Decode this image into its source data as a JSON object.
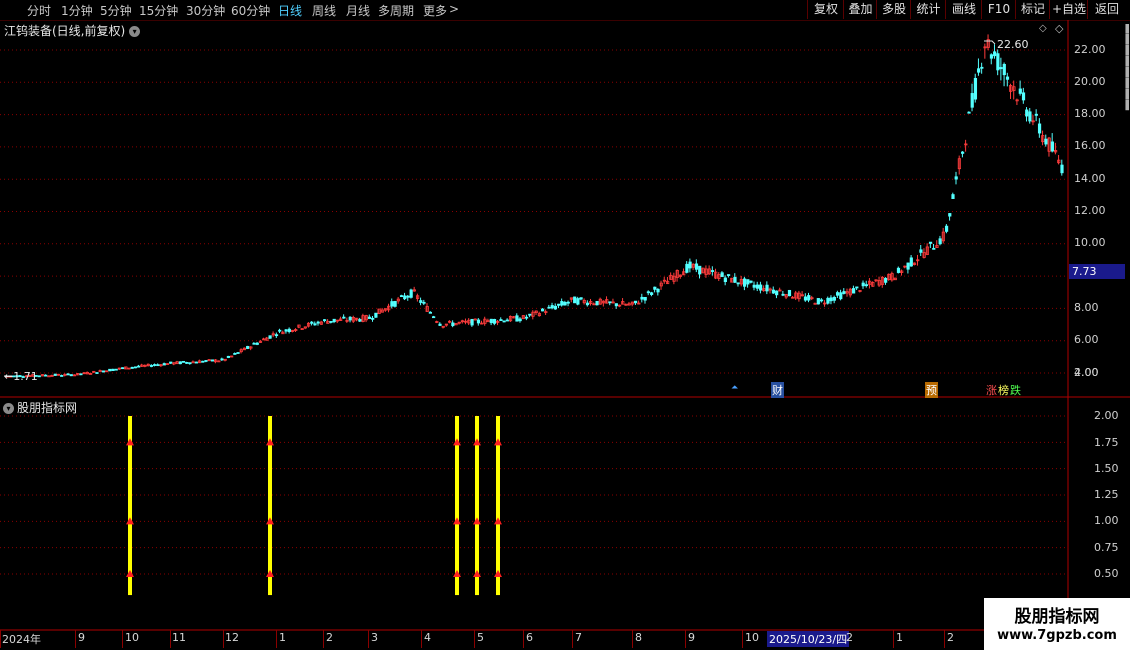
{
  "toolbar": {
    "periods": [
      "分时",
      "1分钟",
      "5分钟",
      "15分钟",
      "30分钟",
      "60分钟",
      "日线",
      "周线",
      "月线",
      "多周期",
      "更多"
    ],
    "more_arrow": ">",
    "active_period": "日线",
    "right_buttons": [
      "复权",
      "叠加",
      "多股",
      "统计",
      "画线",
      "F10",
      "标记",
      "+自选",
      "返回"
    ]
  },
  "main_chart": {
    "title": "江钨装备(日线,前复权)",
    "high_label": "22.60",
    "low_label": "1.71",
    "current_price": "7.73",
    "y_ticks": [
      "22.00",
      "20.00",
      "18.00",
      "16.00",
      "14.00",
      "12.00",
      "10.00",
      "8.00",
      "6.00",
      "4.00",
      "2.00"
    ],
    "markers": [
      "财",
      "预",
      "涨",
      "榜",
      "跌"
    ],
    "colors": {
      "up": "#ff3c3c",
      "down": "#54ffff",
      "grid": "#8a0000",
      "price_badge_bg": "#1a1a8c"
    }
  },
  "indicator": {
    "title": "股朋指标网",
    "y_ticks": [
      "2.00",
      "1.75",
      "1.50",
      "1.25",
      "1.00",
      "0.75",
      "0.50"
    ],
    "bar_color": "#ffff00",
    "arrow_color": "#ff2020"
  },
  "x_axis": {
    "labels": [
      "2024年",
      "9",
      "10",
      "11",
      "12",
      "1",
      "2",
      "3",
      "4",
      "5",
      "6",
      "7",
      "8",
      "9",
      "10",
      "2025/10/23/四",
      "2",
      "1",
      "2"
    ],
    "cursor_label": "2025/10/23/四"
  },
  "watermark": {
    "title": "股朋指标网",
    "url": "www.7gpzb.com"
  },
  "chart_data": [
    {
      "type": "line",
      "title": "江钨装备(日线,前复权)",
      "x": [
        "2024-08",
        "2024-09",
        "2024-10",
        "2024-11",
        "2024-12",
        "2025-01",
        "2025-02",
        "2025-03",
        "2025-04",
        "2025-05",
        "2025-06",
        "2025-07",
        "2025-08",
        "2025-09",
        "2025-10",
        "2025-11",
        "2025-12",
        "2026-01",
        "2026-02",
        "2026-03"
      ],
      "series": [
        {
          "values": [
            1.8,
            1.9,
            2.3,
            2.6,
            2.8,
            4.5,
            5.2,
            5.4,
            7.0,
            5.0,
            5.4,
            6.5,
            6.2,
            8.6,
            7.6,
            6.4,
            8.0,
            10.5,
            22.6,
            14.5
          ]
        }
      ],
      "ylim": [
        1.0,
        23.0
      ],
      "annotations": [
        "22.60",
        "1.71",
        "7.73"
      ]
    },
    {
      "type": "bar",
      "title": "股朋指标网",
      "x": [
        "2024-10",
        "2024-12",
        "2025-04",
        "2025-05",
        "2025-05"
      ],
      "values": [
        2.0,
        2.0,
        2.0,
        2.0,
        2.0
      ],
      "ylim": [
        0.3,
        2.1
      ]
    }
  ]
}
